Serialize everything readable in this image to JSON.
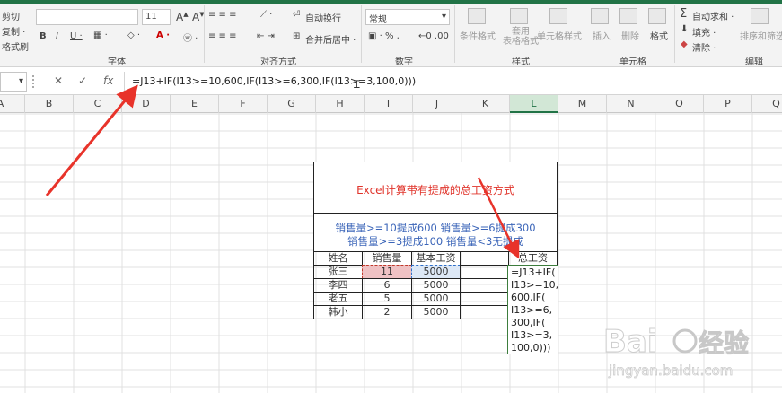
{
  "ribbon": {
    "clipboard": {
      "cut": "剪切",
      "copy": "复制 ·",
      "format_painter": "格式刷"
    },
    "font": {
      "size": "11",
      "group_label": "字体"
    },
    "alignment": {
      "wrap": "自动换行",
      "merge": "合并后居中 ·",
      "group_label": "对齐方式"
    },
    "number": {
      "format": "常规",
      "group_label": "数字"
    },
    "styles": {
      "conditional": "条件格式",
      "table": "套用\n表格格式",
      "cell_styles": "单元格样式",
      "group_label": "样式"
    },
    "cells": {
      "insert": "插入",
      "delete": "删除",
      "format": "格式",
      "group_label": "单元格"
    },
    "editing": {
      "autosum": "自动求和 ·",
      "fill": "填充 ·",
      "clear": "清除 ·",
      "sort": "排序和筛选",
      "group_label": "编辑"
    }
  },
  "formula_bar": {
    "fx_label": "fx",
    "formula": "=J13+IF(I13>=10,600,IF(I13>=6,300,IF(I13>=3,100,0)))"
  },
  "columns": [
    "A",
    "B",
    "C",
    "D",
    "E",
    "F",
    "G",
    "H",
    "I",
    "J",
    "K",
    "L",
    "M",
    "N",
    "O",
    "P",
    "Q"
  ],
  "sheet": {
    "title": "Excel计算带有提成的总工资方式",
    "rule_line1": "销售量>=10提成600  销售量>=6提成300",
    "rule_line2": "销售量>=3提成100  销售量<3无提成",
    "headers": [
      "姓名",
      "销售量",
      "基本工资",
      "",
      "总工资"
    ],
    "rows": [
      [
        "张三",
        "11",
        "5000"
      ],
      [
        "李四",
        "6",
        "5000"
      ],
      [
        "老五",
        "5",
        "5000"
      ],
      [
        "韩小",
        "2",
        "5000"
      ]
    ],
    "l_cell_lines": [
      "=J13+IF(",
      "I13>=10,",
      "600,IF(",
      "I13>=6,",
      "300,IF(",
      "I13>=3,",
      "100,0)))"
    ]
  },
  "colors": {
    "excel_green": "#217346",
    "arrow_red": "#e8332a",
    "title_red": "#e0342b",
    "rule_blue": "#3a64b8"
  }
}
